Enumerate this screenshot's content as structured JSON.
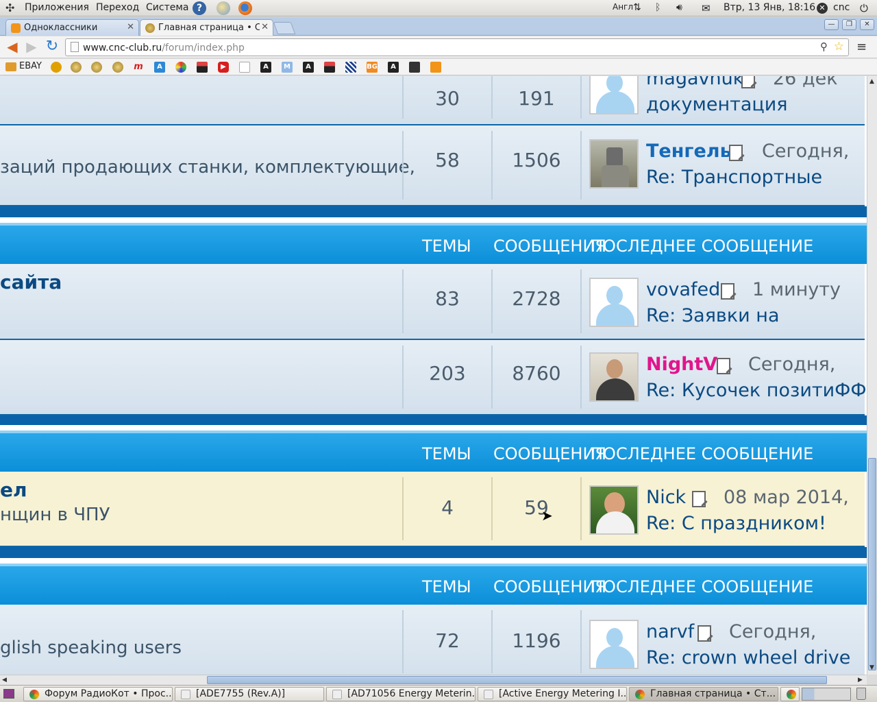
{
  "panel": {
    "menus": [
      "Приложения",
      "Переход",
      "Система"
    ],
    "keyboard": "Англ",
    "datetime": "Втр, 13 Янв, 18:16",
    "user": "cnc"
  },
  "tabs": [
    {
      "label": "Одноклассники"
    },
    {
      "label": "Главная страница • С"
    }
  ],
  "omnibox": {
    "host": "www.cnc-club.ru",
    "path": "/forum/index.php"
  },
  "bookmarks": {
    "ebay_label": "EBAY"
  },
  "headers": {
    "topics": "ТЕМЫ",
    "posts": "СООБЩЕНИЯ",
    "last": "ПОСЛЕДНЕЕ СООБЩЕНИЕ"
  },
  "rows": [
    {
      "title": "",
      "desc": "",
      "topics": "30",
      "posts": "191",
      "author": "magavnuk",
      "when": "26 дек",
      "last": "документация"
    },
    {
      "title": "",
      "desc": "заций продающих станки, комплектующие,",
      "topics": "58",
      "posts": "1506",
      "author": "Тенгель",
      "when": "Сегодня,",
      "last": "Re: Транспортные"
    },
    {
      "title": "сайта",
      "desc": "",
      "topics": "83",
      "posts": "2728",
      "author": "vovafed",
      "when": "1 минуту",
      "last": "Re: Заявки на"
    },
    {
      "title": "",
      "desc": "",
      "topics": "203",
      "posts": "8760",
      "author": "NightV",
      "when": "Сегодня,",
      "last": "Re: Кусочек позитиФФа"
    },
    {
      "title": "ел",
      "desc": "нщин в ЧПУ",
      "topics": "4",
      "posts": "59",
      "author": "Nick",
      "when": "08 мар 2014,",
      "last": "Re: С праздником!"
    },
    {
      "title": "",
      "desc": "glish speaking users",
      "topics": "72",
      "posts": "1196",
      "author": "narvf",
      "when": "Сегодня,",
      "last": "Re: crown wheel drive"
    }
  ],
  "colors": {
    "accent": "#0b8fd8",
    "link": "#0b4a82",
    "nightv": "#e0158c",
    "tengel": "#1469b8"
  },
  "taskbar": [
    {
      "label": "Форум РадиоКот • Прос..."
    },
    {
      "label": "[ADE7755 (Rev.A)]"
    },
    {
      "label": "[AD71056 Energy Meterin..."
    },
    {
      "label": "[Active Energy Metering I..."
    },
    {
      "label": "Главная страница • Ст..."
    }
  ]
}
